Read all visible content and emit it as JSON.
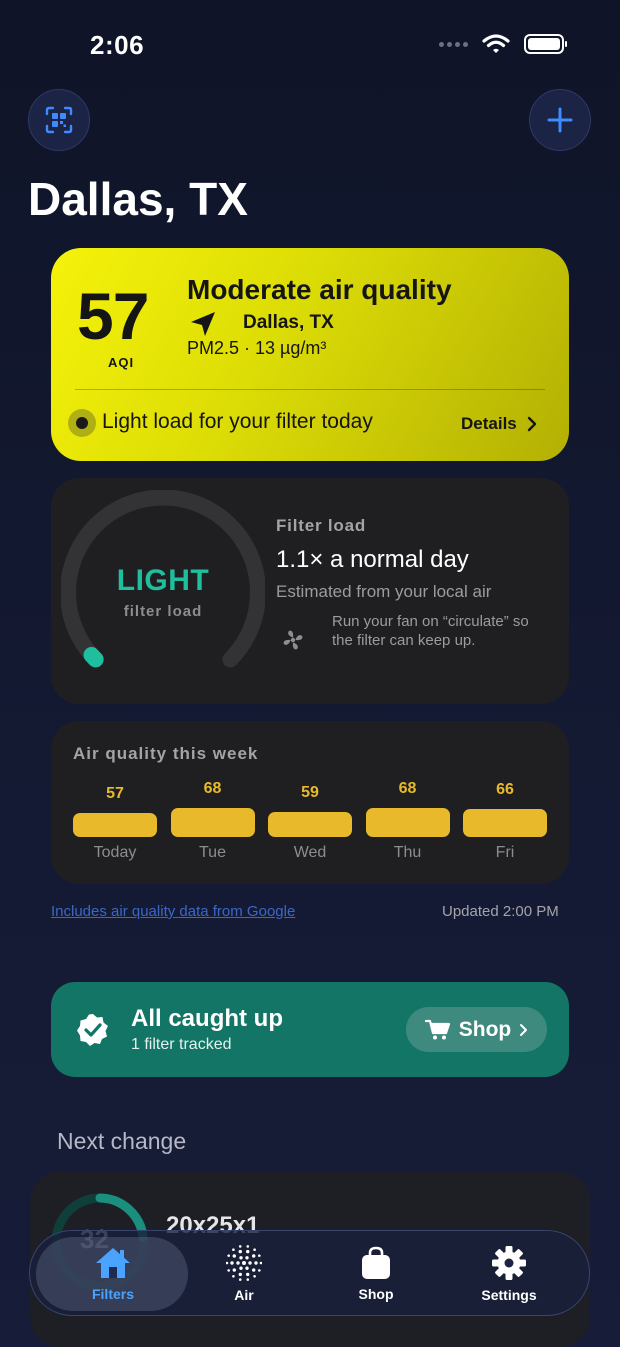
{
  "status_bar": {
    "time": "2:06"
  },
  "header": {
    "city": "Dallas, TX"
  },
  "aqi_card": {
    "aqi_value": "57",
    "aqi_label": "AQI",
    "headline": "Moderate air quality",
    "location": "Dallas, TX",
    "pm": "PM2.5 · 13 µg/m³",
    "load_text": "Light load for your filter today",
    "details_label": "Details",
    "color": "#f5f20a"
  },
  "filter_load": {
    "gauge_main": "LIGHT",
    "gauge_sub": "filter load",
    "label": "Filter load",
    "value": "1.1× a normal day",
    "desc": "Estimated from your local air",
    "tip": "Run your fan on “circulate” so the filter can keep up.",
    "level_fraction": 0.05,
    "accent": "#1fbf9d"
  },
  "week": {
    "title": "Air quality this week",
    "days": [
      {
        "label": "Today",
        "value": "57"
      },
      {
        "label": "Tue",
        "value": "68"
      },
      {
        "label": "Wed",
        "value": "59"
      },
      {
        "label": "Thu",
        "value": "68"
      },
      {
        "label": "Fri",
        "value": "66"
      }
    ],
    "bar_color": "#e8b92a"
  },
  "footer_note": {
    "google_link": "Includes air quality data from Google",
    "updated": "Updated 2:00 PM"
  },
  "caught_up": {
    "title": "All caught up",
    "subtitle": "1 filter tracked",
    "shop_label": "Shop"
  },
  "next_change": {
    "title": "Next change",
    "days": "32",
    "filter_size": "20x25x1"
  },
  "tab_bar": {
    "tabs": [
      {
        "label": "Filters",
        "icon": "home-icon",
        "active": true
      },
      {
        "label": "Air",
        "icon": "air-dots-icon",
        "active": false
      },
      {
        "label": "Shop",
        "icon": "bag-icon",
        "active": false
      },
      {
        "label": "Settings",
        "icon": "gear-icon",
        "active": false
      }
    ]
  }
}
